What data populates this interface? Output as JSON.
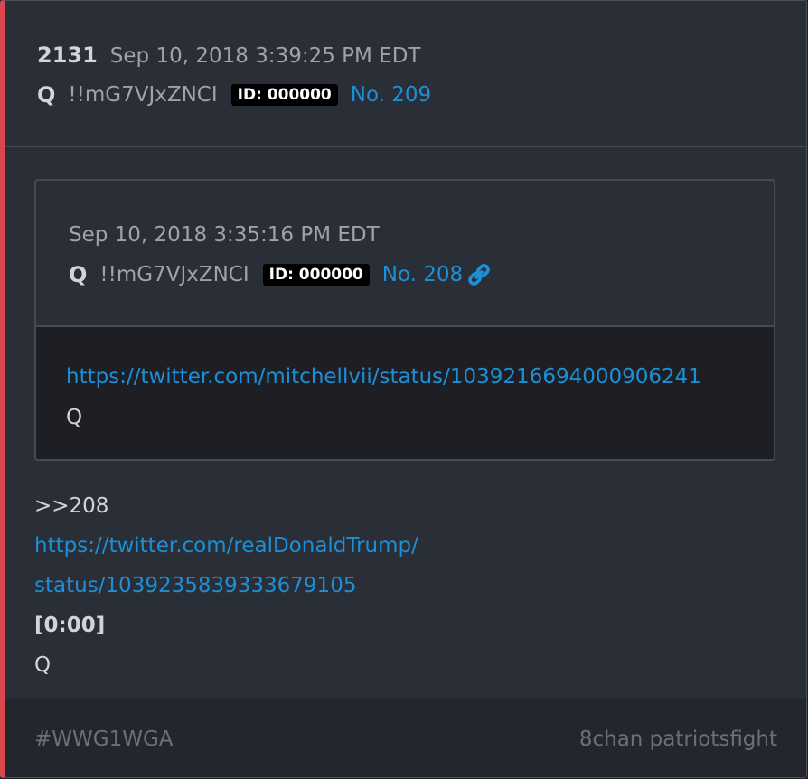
{
  "post": {
    "number": "2131",
    "date": "Sep 10, 2018 3:39:25 PM EDT",
    "author": "Q",
    "tripcode": "!!mG7VJxZNCI",
    "id_badge": "ID: 000000",
    "post_link": "No. 209"
  },
  "quoted_post": {
    "date": "Sep 10, 2018 3:35:16 PM EDT",
    "author": "Q",
    "tripcode": "!!mG7VJxZNCI",
    "id_badge": "ID: 000000",
    "post_link": "No. 208",
    "link_icon": "link-icon",
    "url": "https://twitter.com/mitchellvii/status/1039216694000906241",
    "signature": "Q"
  },
  "body": {
    "reply_ref": ">>208",
    "url_line1": "https://twitter.com/realDonaldTrump/",
    "url_line2": "status/1039235839333679105",
    "timestamp": "[0:00]",
    "signature": "Q"
  },
  "footer": {
    "hashtag": "#WWG1WGA",
    "source": "8chan patriotsfight"
  },
  "colors": {
    "accent_bar": "#d9484e",
    "link": "#1d8fd6",
    "background": "#2a2e37"
  }
}
